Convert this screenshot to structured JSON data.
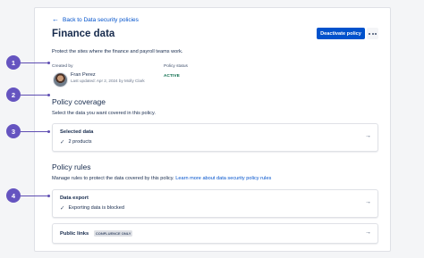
{
  "header": {
    "back_link": "Back to Data security policies",
    "title": "Finance data",
    "deactivate_label": "Deactivate policy",
    "description": "Protect the sites where the finance and payroll teams work."
  },
  "owner": {
    "created_by_label": "Created by",
    "name": "Fran Perez",
    "meta": "Last updated: Apr 2, 2024 by Molly Clark"
  },
  "status": {
    "label": "Policy status",
    "value": "ACTIVE"
  },
  "coverage": {
    "heading": "Policy coverage",
    "subtext": "Select the data you want covered in this policy.",
    "card_title": "Selected data",
    "card_value": "2 products"
  },
  "rules": {
    "heading": "Policy rules",
    "subtext": "Manage rules to protect the data covered by this policy.",
    "learn_more": "Learn more about data security policy rules",
    "export_title": "Data export",
    "export_value": "Exporting data is blocked",
    "public_links_title": "Public links",
    "public_links_badge": "CONFLUENCE ONLY"
  },
  "markers": [
    "1",
    "2",
    "3",
    "4"
  ],
  "colors": {
    "accent": "#0052cc",
    "marker": "#6554c0",
    "active": "#006644"
  }
}
